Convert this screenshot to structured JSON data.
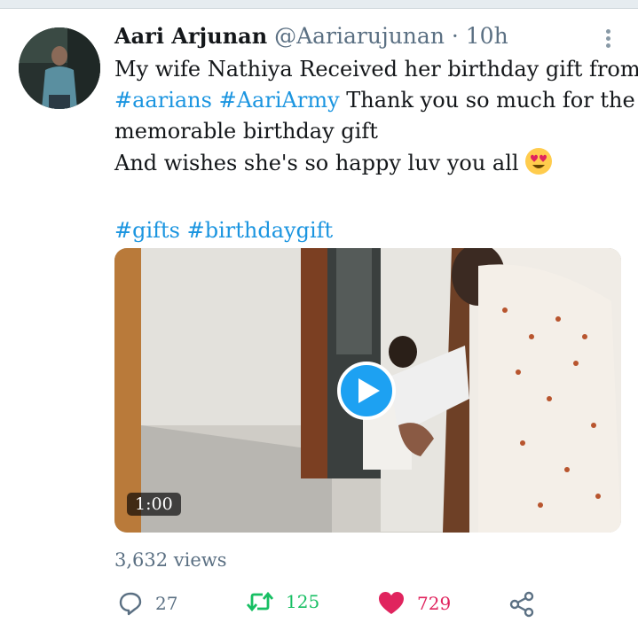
{
  "tweet": {
    "author_name": "Aari Arjunan",
    "handle": "@Aariarujunan",
    "separator": "·",
    "time": "10h",
    "lines": {
      "l1": "My wife Nathiya Received her birthday gift from",
      "l2_tag1": "#aarians",
      "l2_tag2": "#AariArmy",
      "l2_rest": " Thank you so much for the",
      "l3": "memorable birthday gift",
      "l4": "And wishes she's so happy luv you all",
      "hashtag1": "#gifts",
      "hashtag2": "#birthdaygift"
    },
    "emoji_icon": "heart-eyes-emoji-icon"
  },
  "media": {
    "duration": "1:00",
    "play_icon": "play-icon"
  },
  "stats": {
    "views": "3,632 views",
    "replies": "27",
    "retweets": "125",
    "likes": "729"
  },
  "colors": {
    "link": "#1b95e0",
    "retweet": "#17bf63",
    "like": "#e0245e",
    "muted": "#5b7083"
  }
}
